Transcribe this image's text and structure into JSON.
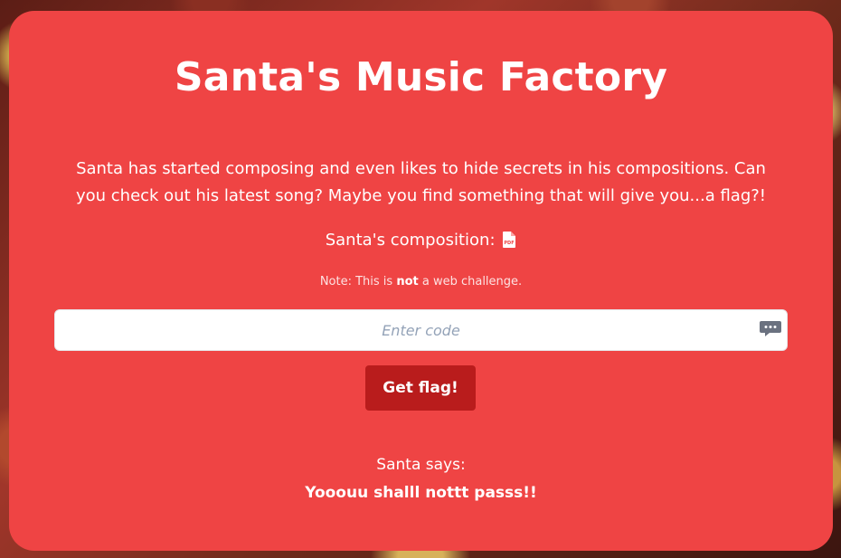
{
  "page": {
    "title": "Santa's Music Factory",
    "intro": "Santa has started composing and even likes to hide secrets in his compositions. Can you check out his latest song? Maybe you find something that will give you...a flag?!",
    "composition_label": "Santa's composition:",
    "pdf_icon": "pdf-file-icon",
    "note_prefix": "Note: This is ",
    "note_bold": "not",
    "note_suffix": " a web challenge."
  },
  "form": {
    "code_placeholder": "Enter code",
    "code_value": "",
    "chat_icon": "chat-bubble-icon",
    "submit_label": "Get flag!"
  },
  "response": {
    "label": "Santa says:",
    "message": "Yooouu shalll nottt passs!!"
  },
  "colors": {
    "card_background": "#ef4444",
    "button_background": "#b91c1c",
    "text": "#ffffff"
  }
}
